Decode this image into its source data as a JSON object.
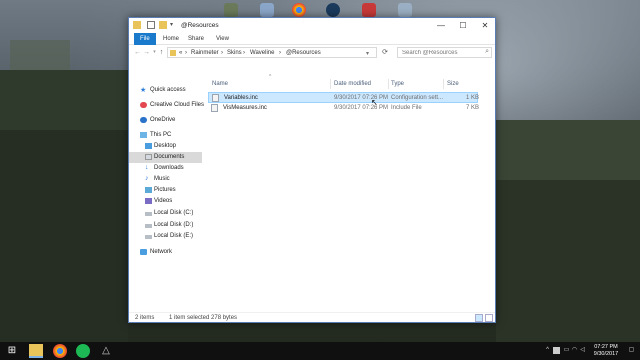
{
  "window": {
    "title": "@Resources",
    "controls": {
      "minimize": "—",
      "maximize": "☐",
      "close": "✕"
    }
  },
  "ribbon": {
    "tabs": [
      "File",
      "Home",
      "Share",
      "View"
    ]
  },
  "address": {
    "prefix": "«",
    "crumbs": [
      "Rainmeter",
      "Skins",
      "Waveline",
      "@Resources"
    ],
    "separator": "›"
  },
  "search": {
    "placeholder": "Search @Resources"
  },
  "nav": {
    "items": [
      {
        "label": "Quick access",
        "icon": "star-icon"
      },
      {
        "label": "Creative Cloud Files",
        "icon": "creative-cloud-icon"
      },
      {
        "label": "OneDrive",
        "icon": "cloud-icon"
      },
      {
        "label": "This PC",
        "icon": "computer-icon"
      },
      {
        "label": "Desktop",
        "icon": "desktop-icon"
      },
      {
        "label": "Documents",
        "icon": "documents-icon"
      },
      {
        "label": "Downloads",
        "icon": "download-icon"
      },
      {
        "label": "Music",
        "icon": "music-icon"
      },
      {
        "label": "Pictures",
        "icon": "pictures-icon"
      },
      {
        "label": "Videos",
        "icon": "videos-icon"
      },
      {
        "label": "Local Disk (C:)",
        "icon": "disk-icon"
      },
      {
        "label": "Local Disk (D:)",
        "icon": "disk-icon"
      },
      {
        "label": "Local Disk (E:)",
        "icon": "disk-icon"
      },
      {
        "label": "Network",
        "icon": "network-icon"
      }
    ]
  },
  "list": {
    "columns": [
      "Name",
      "Date modified",
      "Type",
      "Size"
    ],
    "files": [
      {
        "name": "Variables.inc",
        "date": "9/30/2017 07:26 PM",
        "type": "Configuration sett...",
        "size": "1 KB"
      },
      {
        "name": "VisMeasures.inc",
        "date": "9/30/2017 07:26 PM",
        "type": "Include File",
        "size": "7 KB"
      }
    ]
  },
  "status": {
    "items": "2 items",
    "selected": "1 item selected  278 bytes"
  },
  "taskbar": {
    "time": "07:27 PM",
    "date": "9/30/2017"
  },
  "colors": {
    "accent": "#1979ca",
    "selection": "#cce8ff"
  }
}
